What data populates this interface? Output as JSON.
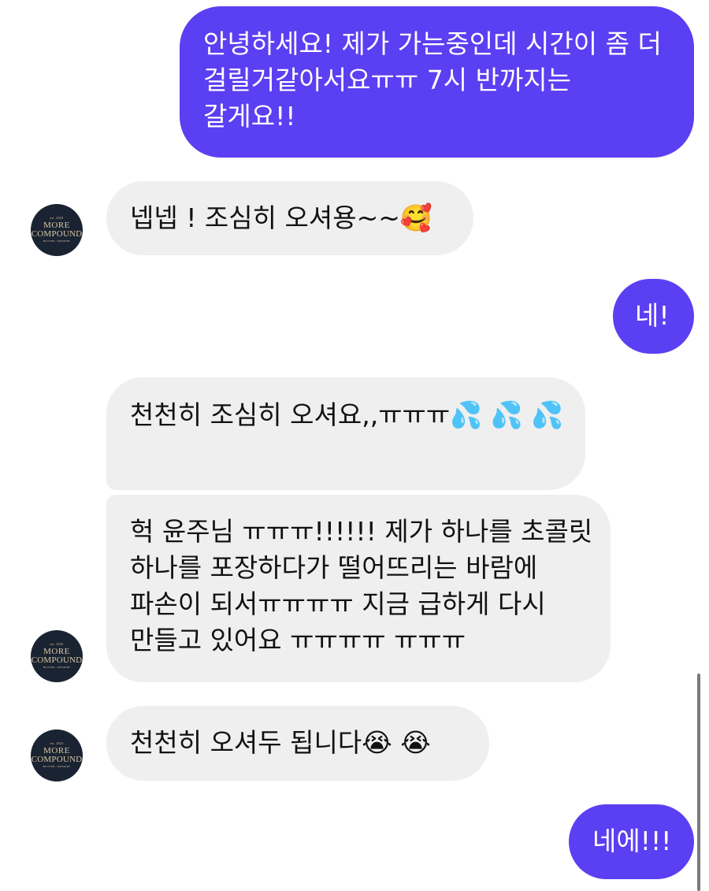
{
  "messages": [
    {
      "id": "m1",
      "from": "me",
      "text": "안녕하세요! 제가 가는중인데 시간이 좀 더 걸릴거같아서요ㅠㅠ 7시 반까지는 갈게요!!"
    },
    {
      "id": "m2",
      "from": "shop",
      "text": "넵넵 ! 조심히 오셔용~~🥰"
    },
    {
      "id": "m3",
      "from": "me",
      "text": "네!"
    },
    {
      "id": "m4",
      "from": "shop",
      "text": "천천히 조심히 오셔요,,ㅠㅠㅠ💦 💦 💦"
    },
    {
      "id": "m5",
      "from": "shop",
      "text": "헉 윤주님 ㅠㅠㅠ!!!!!! 제가 하나를 초콜릿 하나를 포장하다가 떨어뜨리는 바람에 파손이 되서ㅠㅠㅠㅠ 지금 급하게 다시 만들고 있어요 ㅠㅠㅠㅠ ㅠㅠㅠ"
    },
    {
      "id": "m6",
      "from": "shop",
      "text": "천천히 오셔두 됩니다😭 😭"
    },
    {
      "id": "m7",
      "from": "me",
      "text": "네에!!!"
    }
  ],
  "avatar": {
    "est": "est. 2023",
    "line1": "MORE",
    "line2": "COMPOUND",
    "sub": "BUTTER / DESSERT"
  },
  "colors": {
    "sent_bubble": "#5b3ff2",
    "received_bubble": "#efefef",
    "avatar_bg": "#1a2331",
    "avatar_text": "#d9c7a6"
  }
}
